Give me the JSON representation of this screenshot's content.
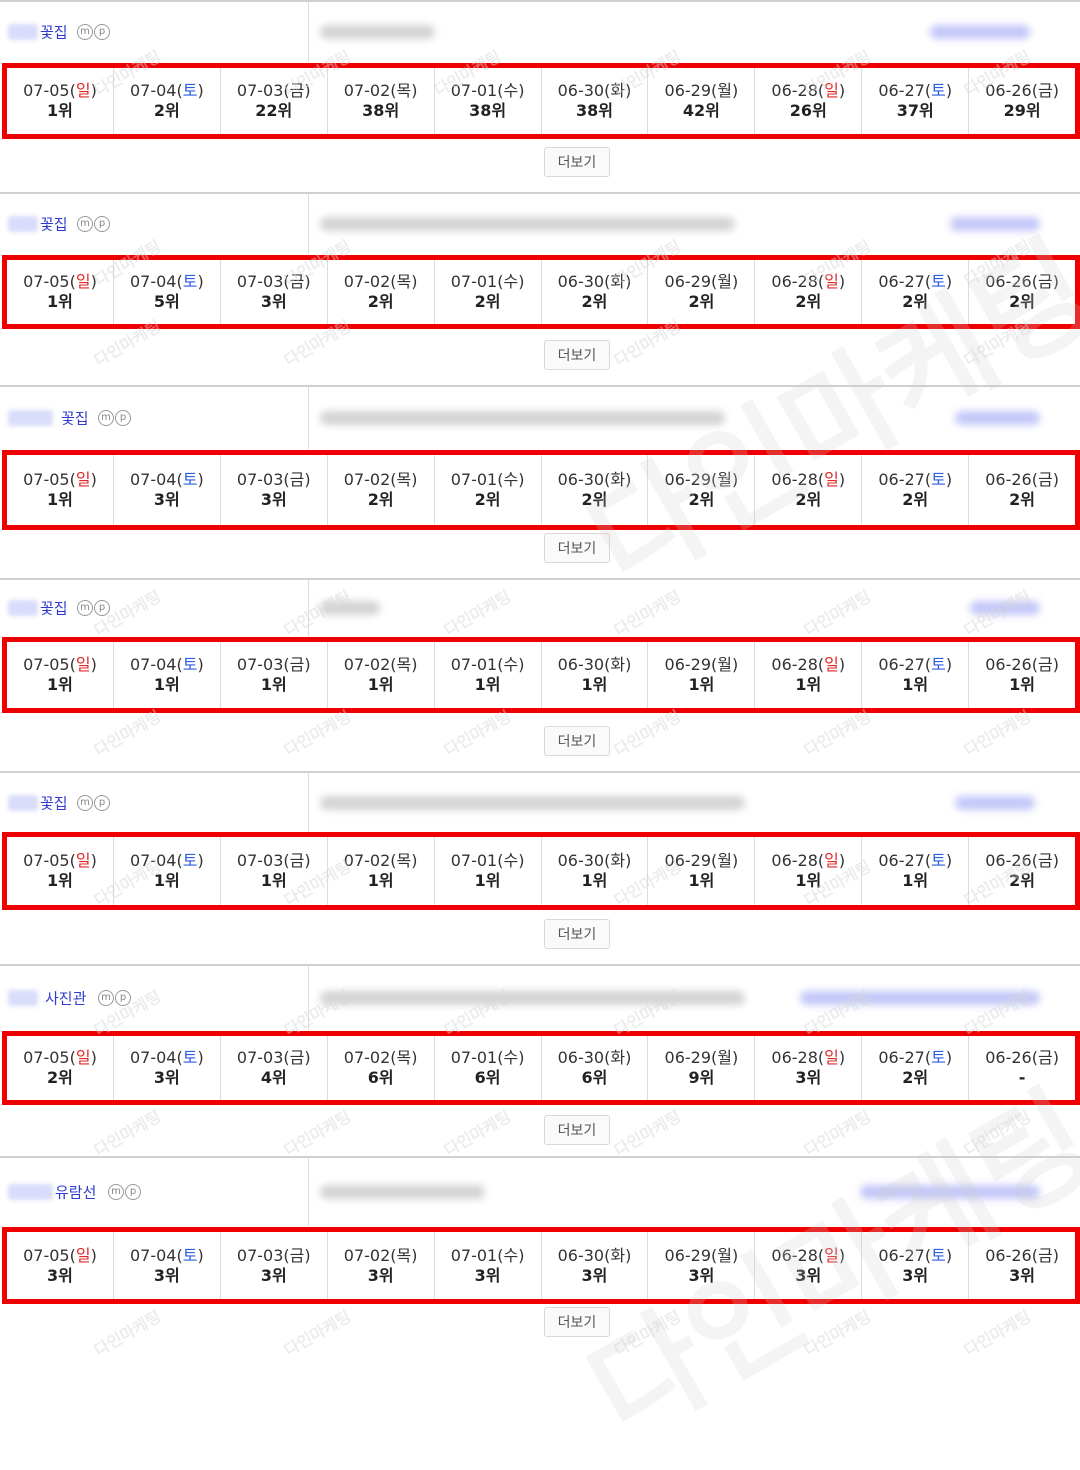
{
  "ui": {
    "more_label": "더보기",
    "mobile_badge": "m",
    "pc_badge": "p"
  },
  "watermark": "다인마케팅",
  "dates": [
    {
      "label": "07-05",
      "day": "일",
      "type": "sun"
    },
    {
      "label": "07-04",
      "day": "토",
      "type": "sat"
    },
    {
      "label": "07-03",
      "day": "금",
      "type": "weekday"
    },
    {
      "label": "07-02",
      "day": "목",
      "type": "weekday"
    },
    {
      "label": "07-01",
      "day": "수",
      "type": "weekday"
    },
    {
      "label": "06-30",
      "day": "화",
      "type": "weekday"
    },
    {
      "label": "06-29",
      "day": "월",
      "type": "weekday"
    },
    {
      "label": "06-28",
      "day": "일",
      "type": "sun"
    },
    {
      "label": "06-27",
      "day": "토",
      "type": "sat"
    },
    {
      "label": "06-26",
      "day": "금",
      "type": "weekday"
    }
  ],
  "blocks": [
    {
      "keyword": "꽃집",
      "ranks": [
        "1위",
        "2위",
        "22위",
        "38위",
        "38위",
        "38위",
        "42위",
        "26위",
        "37위",
        "29위"
      ]
    },
    {
      "keyword": "꽃집",
      "ranks": [
        "1위",
        "5위",
        "3위",
        "2위",
        "2위",
        "2위",
        "2위",
        "2위",
        "2위",
        "2위"
      ]
    },
    {
      "keyword": "꽃집",
      "ranks": [
        "1위",
        "3위",
        "3위",
        "2위",
        "2위",
        "2위",
        "2위",
        "2위",
        "2위",
        "2위"
      ]
    },
    {
      "keyword": "꽃집",
      "ranks": [
        "1위",
        "1위",
        "1위",
        "1위",
        "1위",
        "1위",
        "1위",
        "1위",
        "1위",
        "1위"
      ]
    },
    {
      "keyword": "꽃집",
      "ranks": [
        "1위",
        "1위",
        "1위",
        "1위",
        "1위",
        "1위",
        "1위",
        "1위",
        "1위",
        "2위"
      ]
    },
    {
      "keyword": "사진관",
      "ranks": [
        "2위",
        "3위",
        "4위",
        "6위",
        "6위",
        "6위",
        "9위",
        "3위",
        "2위",
        "-"
      ]
    },
    {
      "keyword": "유람선",
      "ranks": [
        "3위",
        "3위",
        "3위",
        "3위",
        "3위",
        "3위",
        "3위",
        "3위",
        "3위",
        "3위"
      ]
    }
  ],
  "colors": {
    "highlight_border": "#ee0000",
    "sunday": "#e22929",
    "saturday": "#2b5ee0",
    "keyword": "#2f3ad1"
  }
}
